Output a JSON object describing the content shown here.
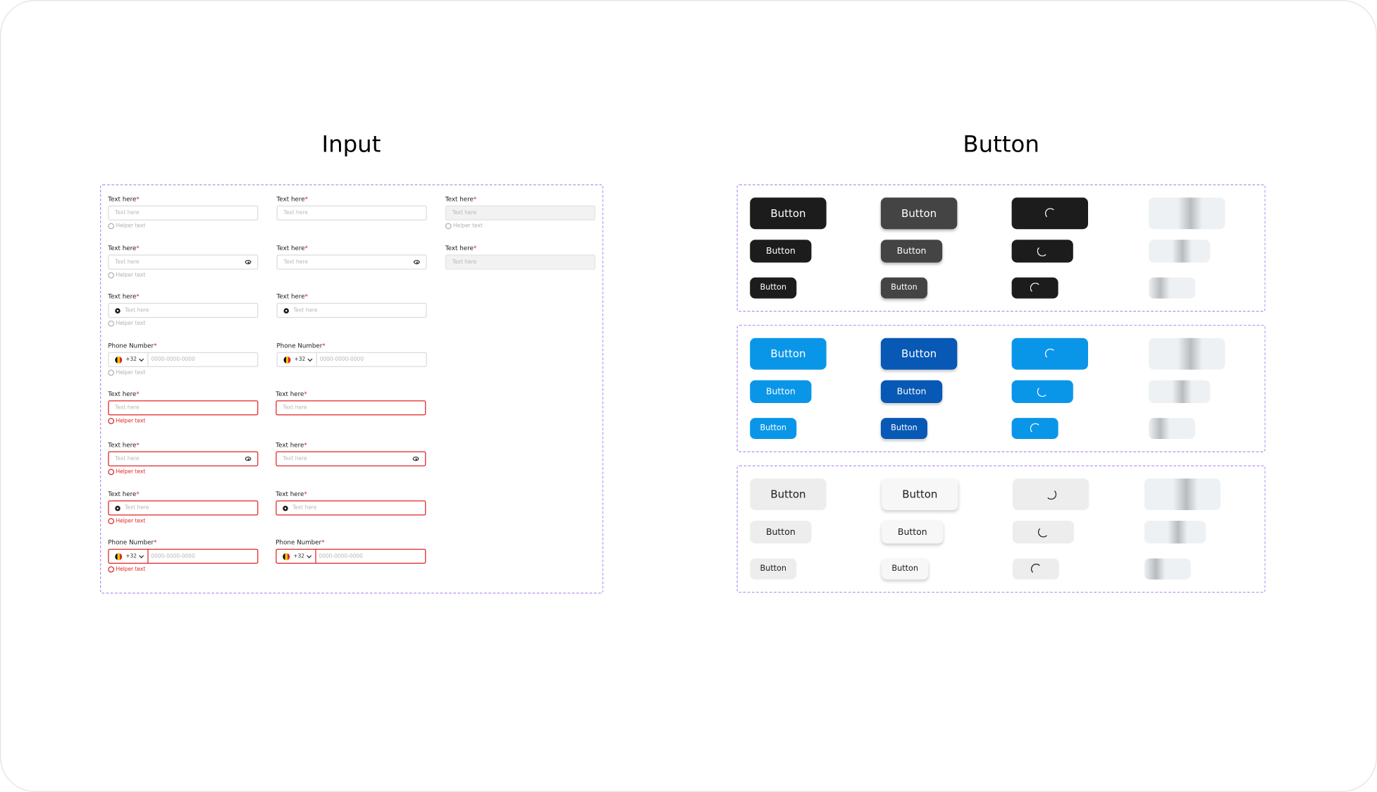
{
  "input_section": {
    "title": "Input",
    "label": "Text here",
    "phone_label": "Phone Number",
    "required_mark": "*",
    "placeholder": "Text here",
    "helper": "Helper text",
    "country_code": "+32",
    "phone_placeholder": "0000-0000-0000"
  },
  "button_section": {
    "title": "Button",
    "label": "Button"
  },
  "colors": {
    "dark": "#1c1c1c",
    "dark_hover": "#444444",
    "blue": "#0a96e8",
    "blue_hover": "#0858b5",
    "light": "#ededed",
    "error": "#e02424",
    "dashed_border": "#b58cf0"
  }
}
